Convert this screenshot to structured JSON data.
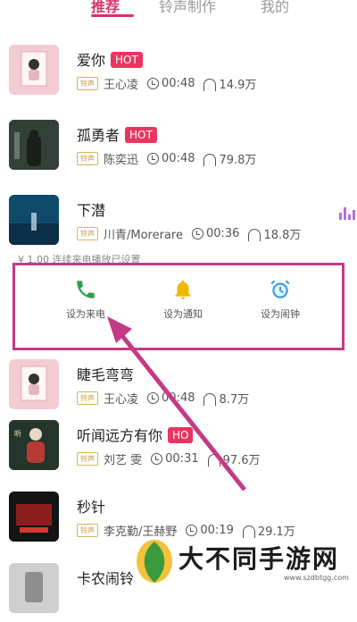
{
  "tabs": [
    {
      "label": "推荐",
      "active": true
    },
    {
      "label": "铃声制作",
      "active": false
    },
    {
      "label": "我的",
      "active": false
    }
  ],
  "songs": [
    {
      "title": "爱你",
      "hot": true,
      "hot_label": "HOT",
      "tag": "铃声",
      "artist": "王心凌",
      "duration": "00:48",
      "plays": "14.9万"
    },
    {
      "title": "孤勇者",
      "hot": true,
      "hot_label": "HOT",
      "tag": "铃声",
      "artist": "陈奕迅",
      "duration": "00:48",
      "plays": "79.8万"
    },
    {
      "title": "下潜",
      "hot": false,
      "tag": "铃声",
      "artist": "川青/Morerare",
      "duration": "00:36",
      "plays": "18.8万",
      "playing": true
    },
    {
      "title": "睫毛弯弯",
      "hot": false,
      "tag": "铃声",
      "artist": "王心凌",
      "duration": "00:48",
      "plays": "8.7万"
    },
    {
      "title": "听闻远方有你",
      "hot": true,
      "hot_label": "HO",
      "tag": "铃声",
      "artist": "刘艺 雯",
      "duration": "00:31",
      "plays": "97.6万"
    },
    {
      "title": "秒针",
      "hot": false,
      "tag": "铃声",
      "artist": "李克勤/王赫野",
      "duration": "00:19",
      "plays": "29.1万"
    },
    {
      "title": "卡农闹铃",
      "hot": false
    }
  ],
  "partial_hint": "¥ 1.00  连续来电播放已设置",
  "actions": [
    {
      "label": "设为来电",
      "icon": "phone-icon",
      "color": "#2e9e4f"
    },
    {
      "label": "设为通知",
      "icon": "bell-icon",
      "color": "#f2b705"
    },
    {
      "label": "设为闹钟",
      "icon": "alarm-clock-icon",
      "color": "#3a9be6"
    }
  ],
  "watermark": {
    "text": "大不同手游网",
    "url": "www.szdbtgg.com"
  },
  "colors": {
    "accent": "#d6336c",
    "hot": "#e8365e",
    "highlight_box": "#c43a86"
  }
}
